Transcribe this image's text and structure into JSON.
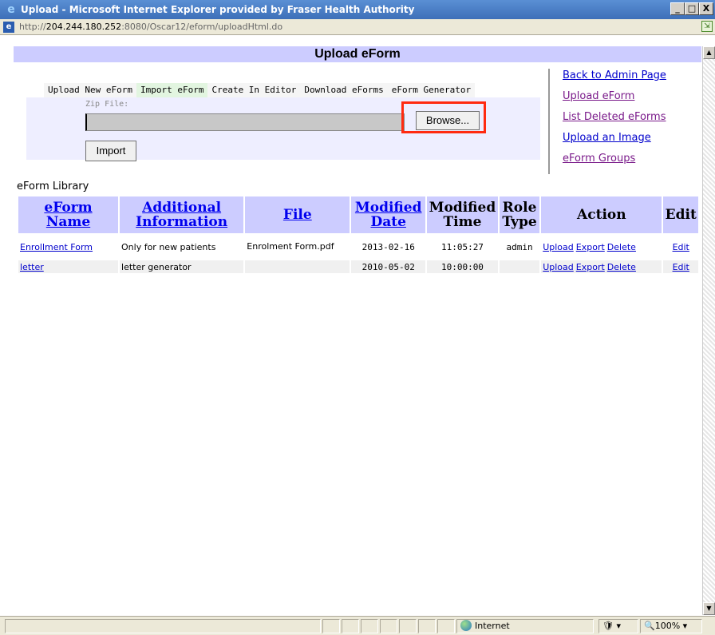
{
  "window": {
    "title": "Upload - Microsoft Internet Explorer provided by Fraser Health Authority",
    "min": "_",
    "max": "□",
    "close": "X"
  },
  "address": {
    "prefix": "http://",
    "host": "204.244.180.252",
    "rest": ":8080/Oscar12/eform/uploadHtml.do"
  },
  "header": {
    "title": "Upload eForm"
  },
  "tabs": [
    "Upload New eForm",
    "Import eForm",
    "Create In Editor",
    "Download eForms",
    "eForm Generator"
  ],
  "active_tab": "Import eForm",
  "upload": {
    "zip_label": "Zip File:",
    "browse_label": "Browse...",
    "import_label": "Import"
  },
  "side_links": [
    "Back to Admin Page",
    "Upload eForm",
    "List Deleted eForms",
    "Upload an Image",
    "eForm Groups"
  ],
  "library": {
    "title": "eForm Library",
    "columns": [
      "eForm Name",
      "Additional Information",
      "File",
      "Modified Date",
      "Modified Time",
      "Role Type",
      "Action",
      "Edit"
    ],
    "rows": [
      {
        "name": "Enrollment Form",
        "info": "Only for new patients",
        "file": "Enrolment Form.pdf",
        "date": "2013-02-16",
        "time": "11:05:27",
        "role": "admin",
        "actions": [
          "Upload",
          "Export",
          "Delete"
        ],
        "edit": "Edit"
      },
      {
        "name": "letter",
        "info": "letter generator",
        "file": "",
        "date": "2010-05-02",
        "time": "10:00:00",
        "role": "",
        "actions": [
          "Upload",
          "Export",
          "Delete"
        ],
        "edit": "Edit"
      }
    ]
  },
  "status": {
    "zone": "Internet",
    "zoom": "100%"
  }
}
